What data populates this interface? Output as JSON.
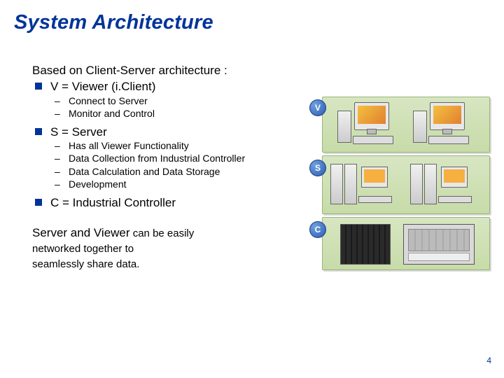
{
  "title": "System Architecture",
  "intro": "Based on Client-Server architecture :",
  "bullets": {
    "vline": "V = Viewer (i.Client)",
    "vsubs": [
      "Connect to Server",
      "Monitor and Control"
    ],
    "sline": "S = Server",
    "ssubs": [
      "Has all Viewer Functionality",
      "Data Collection from Industrial Controller",
      "Data Calculation and Data Storage",
      "Development"
    ],
    "cline": "C = Industrial Controller"
  },
  "closing": {
    "line1a": "Server and Viewer",
    "line1b": " can be easily",
    "line2": "networked together to",
    "line3": "seamlessly share data."
  },
  "diagram": {
    "labelV": "V",
    "labelS": "S",
    "labelC": "C"
  },
  "page_number": "4"
}
